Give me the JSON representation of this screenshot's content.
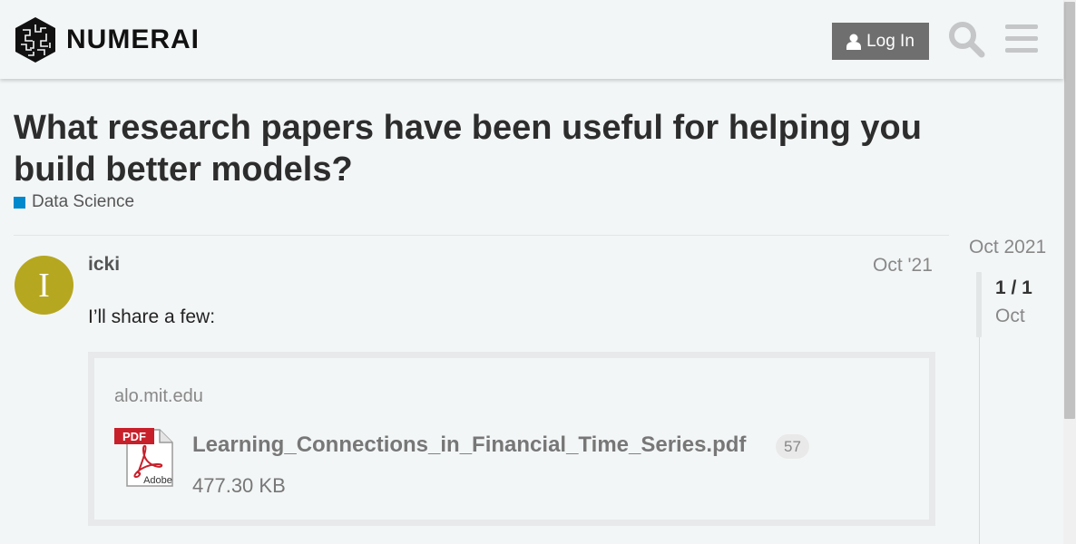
{
  "header": {
    "logo_text": "NUMERAI",
    "login_label": "Log In",
    "icons": {
      "user": "user-icon",
      "search": "search-icon",
      "menu": "hamburger-menu-icon"
    }
  },
  "topic": {
    "title": "What research papers have been useful for helping you build better models?",
    "category": {
      "label": "Data Science",
      "color": "#0088cc"
    }
  },
  "post": {
    "avatar_letter": "I",
    "avatar_color": "#b6a720",
    "username": "icki",
    "date": "Oct '21",
    "text": "I’ll share a few:",
    "onebox": {
      "source": "alo.mit.edu",
      "icon": "pdf-adobe-icon",
      "filename": "Learning_Connections_in_Financial_Time_Series.pdf",
      "clicks": "57",
      "size": "477.30 KB"
    }
  },
  "timeline": {
    "top_date": "Oct 2021",
    "count": "1 / 1",
    "current_date": "Oct"
  }
}
